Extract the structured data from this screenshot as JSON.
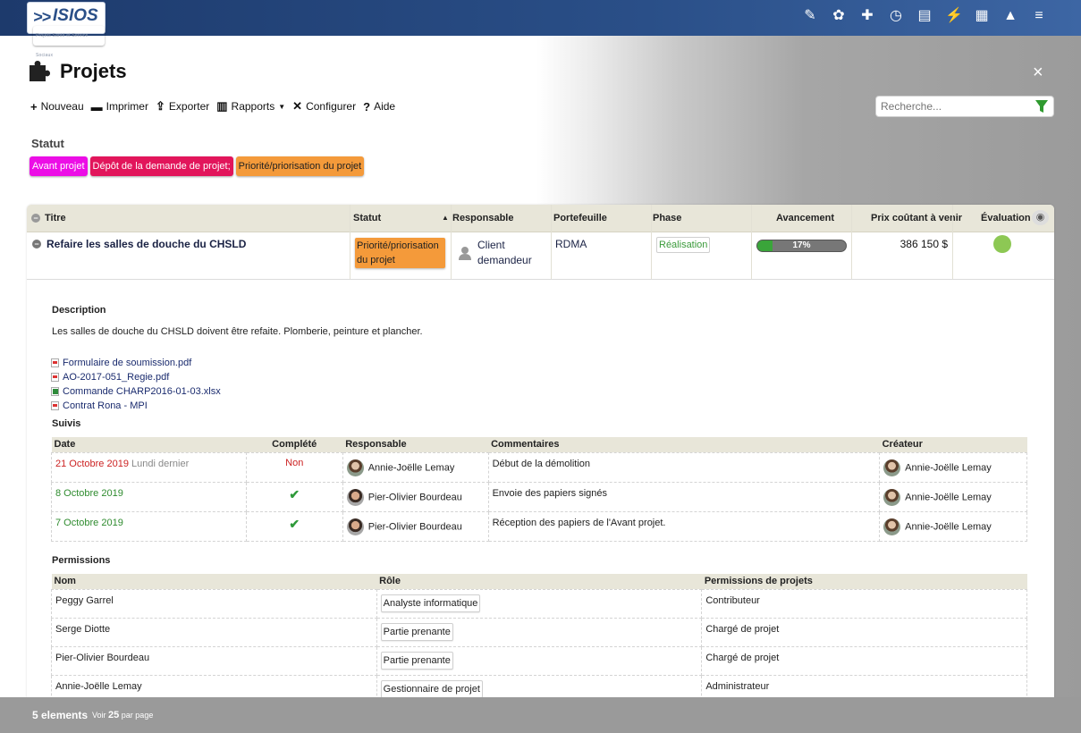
{
  "app": {
    "logo_word": "ISIOS",
    "logo_mark": ">>",
    "logo_tagline": "Projets Santé et Service Sociaux",
    "topbar_icons": [
      "pin-icon",
      "brain-icon",
      "puzzle-icon",
      "stopwatch-icon",
      "document-icon",
      "lightning-icon",
      "calendar-icon",
      "bell-icon",
      "menu-icon"
    ],
    "topbar_glyphs": [
      "✎",
      "✿",
      "✚",
      "◷",
      "▤",
      "⚡",
      "▦",
      "▲",
      "≡"
    ]
  },
  "page": {
    "title": "Projets",
    "close": "×",
    "toolbar": {
      "new": "Nouveau",
      "print": "Imprimer",
      "export": "Exporter",
      "reports": "Rapports",
      "configure": "Configurer",
      "help": "Aide"
    },
    "search_placeholder": "Recherche..."
  },
  "status_filter": {
    "heading": "Statut",
    "tags": [
      {
        "label": "Avant projet",
        "color": "#ec0ee6"
      },
      {
        "label": "Dépôt de la demande de projet;",
        "color": "#e2155b"
      },
      {
        "label": "Priorité/priorisation du projet",
        "color": "#f49a3a"
      }
    ]
  },
  "table": {
    "columns": [
      "Titre",
      "Statut",
      "Responsable",
      "Portefeuille",
      "Phase",
      "Avancement",
      "Prix coûtant à venir",
      "Évaluation"
    ],
    "row": {
      "title": "Refaire les salles de douche du CHSLD",
      "statut": "Priorité/priorisation du projet",
      "responsable_line1": "Client",
      "responsable_line2": "demandeur",
      "portefeuille": "RDMA",
      "phase": "Réalisation",
      "avancement_label": "17%",
      "avancement_value": 0.17,
      "prix": "386 150 $",
      "evaluation_color": "#8dc854"
    }
  },
  "detail": {
    "description_heading": "Description",
    "description": "Les salles de douche du CHSLD doivent être refaite. Plomberie, peinture et plancher.",
    "files": [
      {
        "name": "Formulaire de soumission.pdf",
        "type": "pdf"
      },
      {
        "name": "AO-2017-051_Regie.pdf",
        "type": "pdf"
      },
      {
        "name": "Commande CHARP2016-01-03.xlsx",
        "type": "xls"
      },
      {
        "name": "Contrat Rona - MPI",
        "type": "pdf"
      }
    ],
    "suivis": {
      "heading": "Suivis",
      "columns": [
        "Date",
        "Complété",
        "Responsable",
        "Commentaires",
        "Créateur"
      ],
      "rows": [
        {
          "date": "21 Octobre 2019",
          "date_extra": "Lundi dernier",
          "date_color": "#cc2222",
          "complete": "Non",
          "responsable": "Annie-Joëlle Lemay",
          "commentaire": "Début de la démolition",
          "createur": "Annie-Joëlle Lemay"
        },
        {
          "date": "8 Octobre 2019",
          "date_extra": "",
          "date_color": "#2e8b2e",
          "complete": "✔",
          "responsable": "Pier-Olivier Bourdeau",
          "commentaire": "Envoie des papiers signés",
          "createur": "Annie-Joëlle Lemay"
        },
        {
          "date": "7 Octobre 2019",
          "date_extra": "",
          "date_color": "#2e8b2e",
          "complete": "✔",
          "responsable": "Pier-Olivier Bourdeau",
          "commentaire": "Réception des papiers de l'Avant projet.",
          "createur": "Annie-Joëlle Lemay"
        }
      ]
    },
    "permissions": {
      "heading": "Permissions",
      "columns": [
        "Nom",
        "Rôle",
        "Permissions de projets"
      ],
      "rows": [
        {
          "nom": "Peggy Garrel",
          "role": "Analyste informatique",
          "perm": "Contributeur"
        },
        {
          "nom": "Serge Diotte",
          "role": "Partie prenante",
          "perm": "Chargé de projet"
        },
        {
          "nom": "Pier-Olivier Bourdeau",
          "role": "Partie prenante",
          "perm": "Chargé de projet"
        },
        {
          "nom": "Annie-Joëlle Lemay",
          "role": "Gestionnaire de projet",
          "perm": "Administrateur"
        }
      ]
    }
  },
  "footer": {
    "count": "5 elements",
    "see": "Voir",
    "per_page_value": "25",
    "per_page": "par page"
  }
}
